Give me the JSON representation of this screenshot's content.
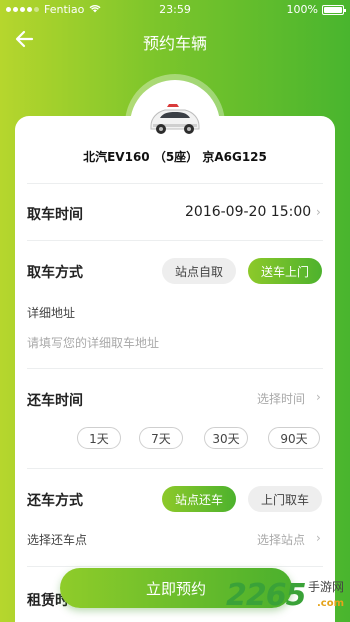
{
  "status_bar": {
    "carrier": "Fentiao",
    "time": "23:59",
    "battery": "100%"
  },
  "header": {
    "title": "预约车辆"
  },
  "car": {
    "name": "北汽EV160 （5座） 京A6G125"
  },
  "pickup_time": {
    "label": "取车时间",
    "value": "2016-09-20  15:00"
  },
  "pickup_method": {
    "label": "取车方式",
    "options": [
      "站点自取",
      "送车上门"
    ],
    "selected": "送车上门",
    "address_label": "详细地址",
    "address_placeholder": "请填写您的详细取车地址"
  },
  "return_time": {
    "label": "还车时间",
    "hint": "选择时间",
    "days": [
      "1天",
      "7天",
      "30天",
      "90天"
    ]
  },
  "return_method": {
    "label": "还车方式",
    "options": [
      "站点还车",
      "上门取车"
    ],
    "selected": "站点还车",
    "station_label": "选择还车点",
    "station_hint": "选择站点"
  },
  "rental": {
    "label": "租赁时"
  },
  "cta": {
    "label": "立即预约"
  },
  "watermark": {
    "brand": "2265",
    "site": "手游网",
    "url": ".com"
  },
  "colors": {
    "accent_start": "#8fcc2a",
    "accent_end": "#4bb02d"
  }
}
